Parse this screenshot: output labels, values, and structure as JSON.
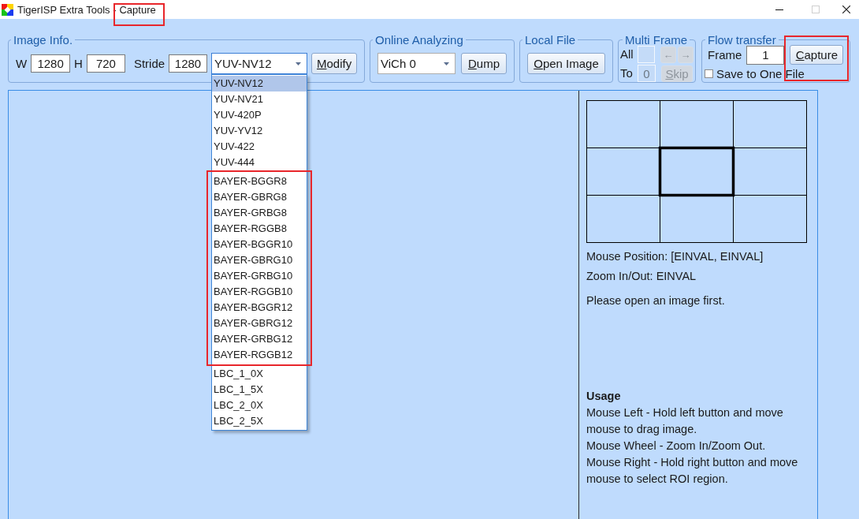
{
  "window": {
    "title": "TigerISP Extra Tools -",
    "subtitle": "Capture",
    "subtitle_highlighted": true,
    "controls": [
      {
        "kind": "minimize",
        "disabled": false
      },
      {
        "kind": "maximize",
        "disabled": true
      },
      {
        "kind": "close",
        "disabled": false
      }
    ]
  },
  "image_info": {
    "legend": "Image Info.",
    "fields": [
      {
        "label": "W",
        "value": "1280"
      },
      {
        "label": "H",
        "value": "720"
      },
      {
        "label": "Stride",
        "value": "1280"
      }
    ],
    "format": {
      "value": "YUV-NV12",
      "expanded": true,
      "option_groups": [
        {
          "highlighted": false,
          "options": [
            {
              "label": "YUV-NV12",
              "selected": true
            },
            {
              "label": "YUV-NV21",
              "selected": false
            },
            {
              "label": "YUV-420P",
              "selected": false
            },
            {
              "label": "YUV-YV12",
              "selected": false
            },
            {
              "label": "YUV-422",
              "selected": false
            },
            {
              "label": "YUV-444",
              "selected": false
            }
          ]
        },
        {
          "highlighted": true,
          "options": [
            {
              "label": "BAYER-BGGR8",
              "selected": false
            },
            {
              "label": "BAYER-GBRG8",
              "selected": false
            },
            {
              "label": "BAYER-GRBG8",
              "selected": false
            },
            {
              "label": "BAYER-RGGB8",
              "selected": false
            },
            {
              "label": "BAYER-BGGR10",
              "selected": false
            },
            {
              "label": "BAYER-GBRG10",
              "selected": false
            },
            {
              "label": "BAYER-GRBG10",
              "selected": false
            },
            {
              "label": "BAYER-RGGB10",
              "selected": false
            },
            {
              "label": "BAYER-BGGR12",
              "selected": false
            },
            {
              "label": "BAYER-GBRG12",
              "selected": false
            },
            {
              "label": "BAYER-GRBG12",
              "selected": false
            },
            {
              "label": "BAYER-RGGB12",
              "selected": false
            }
          ]
        },
        {
          "highlighted": false,
          "options": [
            {
              "label": "LBC_1_0X",
              "selected": false
            },
            {
              "label": "LBC_1_5X",
              "selected": false
            },
            {
              "label": "LBC_2_0X",
              "selected": false
            },
            {
              "label": "LBC_2_5X",
              "selected": false
            }
          ]
        }
      ]
    },
    "button": {
      "label": "Modify",
      "underline_first": true
    }
  },
  "online_analyzing": {
    "legend": "Online Analyzing",
    "channel": {
      "value": "ViCh 0"
    },
    "button": {
      "label": "Dump",
      "underline_first": true
    }
  },
  "local_file": {
    "legend": "Local File",
    "button": {
      "label": "Open Image",
      "underline_first": true
    }
  },
  "multi_frame": {
    "legend": "Multi Frame",
    "rows": [
      {
        "label": "All",
        "field": {
          "disabled": true
        },
        "buttons": [
          {
            "label": "←",
            "disabled": true
          },
          {
            "label": "→",
            "disabled": true
          }
        ]
      },
      {
        "label": "To",
        "field": {
          "value": "0",
          "disabled": true
        },
        "buttons": [
          {
            "label": "Skip",
            "disabled": true,
            "underline_first": true
          }
        ]
      }
    ]
  },
  "flow_transfer": {
    "legend": "Flow transfer",
    "frame": {
      "label": "Frame",
      "value": "1"
    },
    "capture": {
      "label": "Capture",
      "underline_first": true,
      "highlighted": true
    },
    "save_to_one_file": {
      "label": "Save to One File",
      "checked": false
    }
  },
  "viewer": {
    "mouse_position": "Mouse Position: [EINVAL, EINVAL]",
    "zoom": "Zoom In/Out: EINVAL",
    "message": "Please open an image first.",
    "usage": {
      "title": "Usage",
      "lines": [
        "Mouse Left - Hold left button and move mouse to drag image.",
        "Mouse Wheel - Zoom In/Zoom Out.",
        "Mouse Right - Hold right button and move mouse to select ROI region."
      ]
    }
  }
}
